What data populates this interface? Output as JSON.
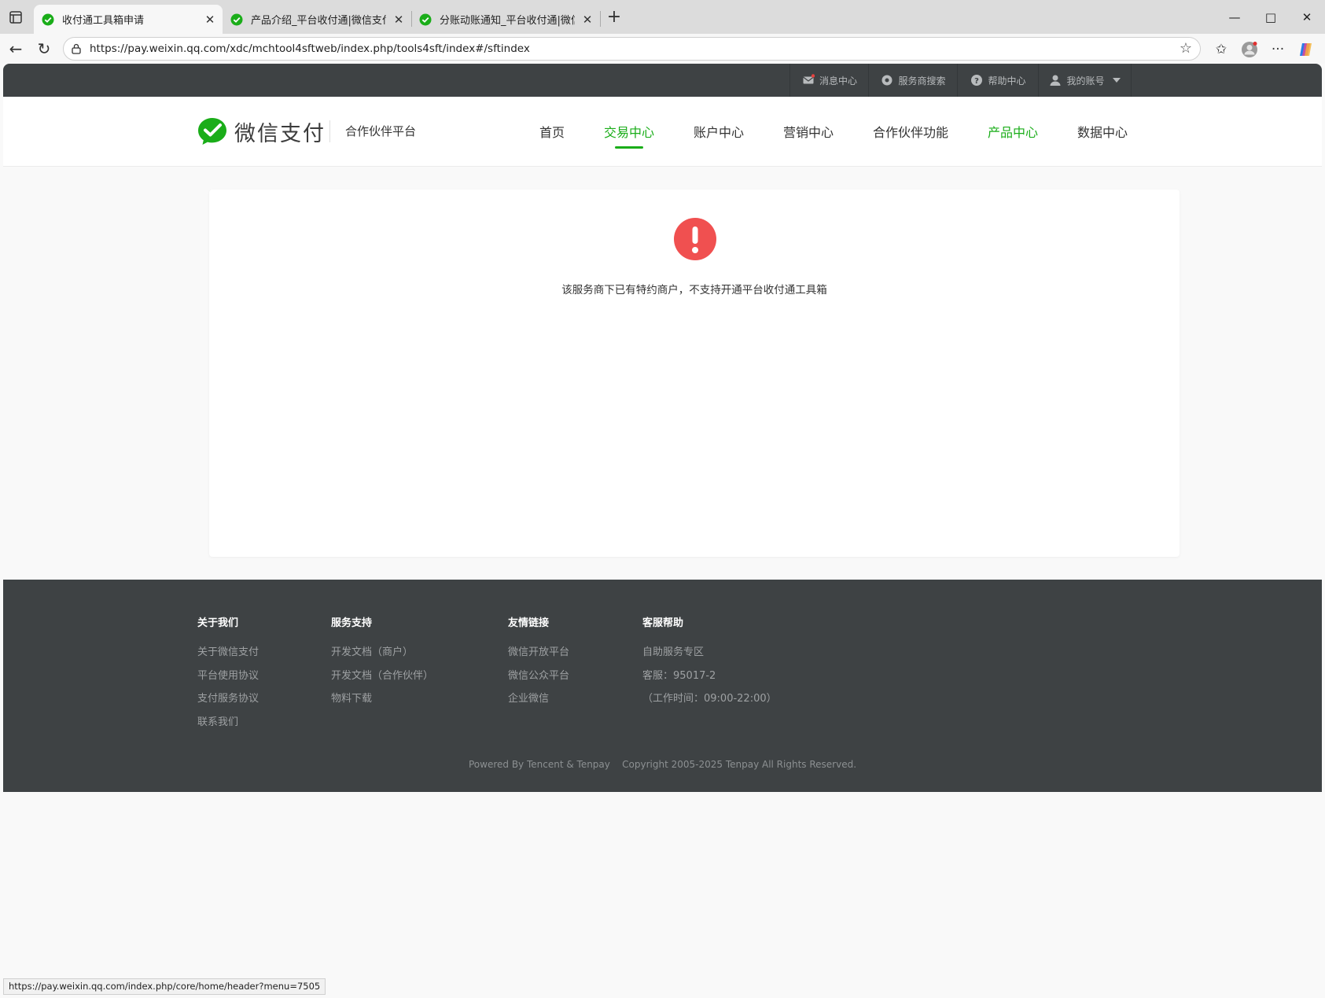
{
  "browser": {
    "tabs": [
      {
        "title": "收付通工具箱申请",
        "active": true
      },
      {
        "title": "产品介绍_平台收付通|微信支付合",
        "active": false
      },
      {
        "title": "分账动账通知_平台收付通|微信支",
        "active": false
      }
    ],
    "new_tab_label": "+",
    "url": "https://pay.weixin.qq.com/xdc/mchtool4sftweb/index.php/tools4sft/index#/sftindex",
    "status_url": "https://pay.weixin.qq.com/index.php/core/home/header?menu=7505"
  },
  "topbar": {
    "items": [
      {
        "label": "消息中心",
        "icon": "mail-icon"
      },
      {
        "label": "服务商搜索",
        "icon": "search-icon"
      },
      {
        "label": "帮助中心",
        "icon": "help-icon"
      },
      {
        "label": "我的账号",
        "icon": "user-icon"
      }
    ]
  },
  "header": {
    "brand": "微信支付",
    "platform": "合作伙伴平台",
    "nav": [
      {
        "label": "首页",
        "state": "normal"
      },
      {
        "label": "交易中心",
        "state": "active"
      },
      {
        "label": "账户中心",
        "state": "normal"
      },
      {
        "label": "营销中心",
        "state": "normal"
      },
      {
        "label": "合作伙伴功能",
        "state": "normal"
      },
      {
        "label": "产品中心",
        "state": "highlight"
      },
      {
        "label": "数据中心",
        "state": "normal"
      }
    ]
  },
  "main": {
    "alert_icon": "exclamation-circle-icon",
    "message": "该服务商下已有特约商户，不支持开通平台收付通工具箱"
  },
  "footer": {
    "columns": [
      {
        "title": "关于我们",
        "links": [
          "关于微信支付",
          "平台使用协议",
          "支付服务协议",
          "联系我们"
        ]
      },
      {
        "title": "服务支持",
        "links": [
          "开发文档（商户）",
          "开发文档（合作伙伴）",
          "物料下载"
        ]
      },
      {
        "title": "友情链接",
        "links": [
          "微信开放平台",
          "微信公众平台",
          "企业微信"
        ]
      },
      {
        "title": "客服帮助",
        "links": [
          "自助服务专区",
          "客服：95017-2",
          "（工作时间：09:00-22:00）"
        ]
      }
    ],
    "powered_by": "Powered By Tencent & Tenpay",
    "copyright": "Copyright 2005-2025 Tenpay All Rights Reserved."
  },
  "colors": {
    "brand_green": "#1aad19",
    "dark_bar": "#3e4244",
    "alert_red": "#f05050"
  }
}
